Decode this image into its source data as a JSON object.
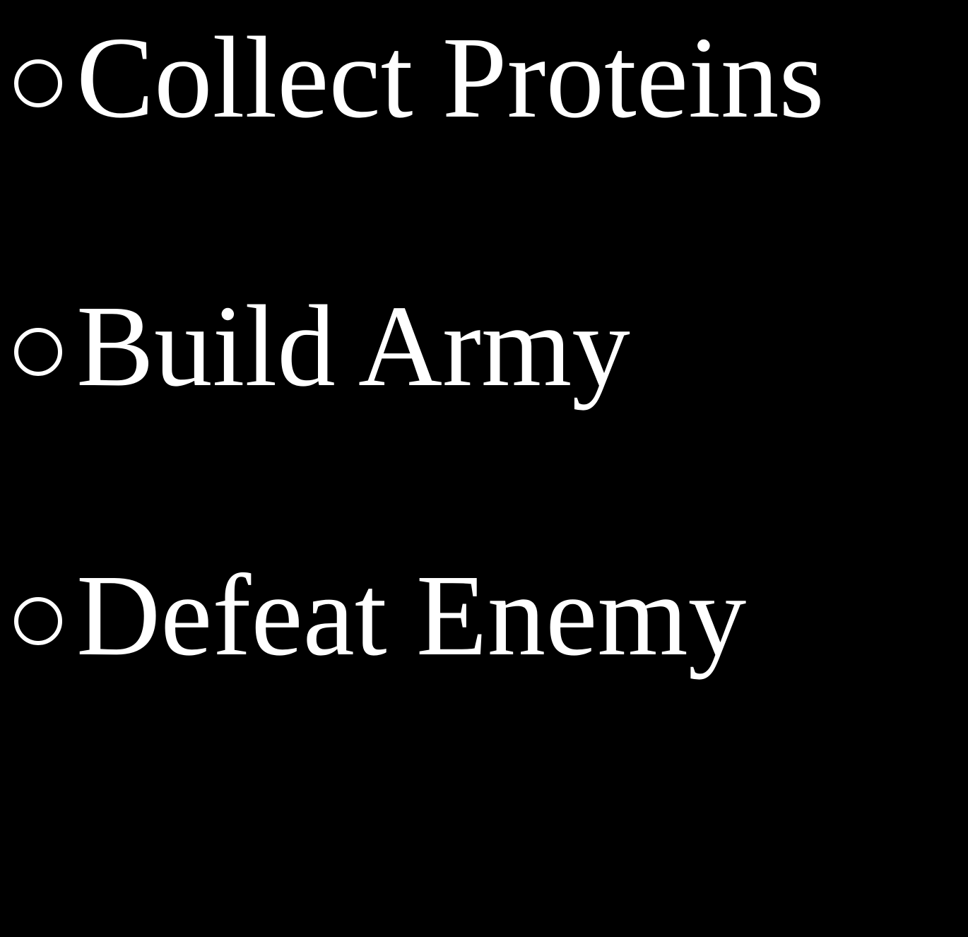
{
  "theme": {
    "background": "#000000",
    "text_color": "#ffffff"
  },
  "objectives": [
    {
      "label": "Collect Proteins",
      "bullet_icon": "hollow-circle-icon"
    },
    {
      "label": "Build Army",
      "bullet_icon": "hollow-circle-icon"
    },
    {
      "label": "Defeat Enemy",
      "bullet_icon": "hollow-circle-icon"
    }
  ]
}
